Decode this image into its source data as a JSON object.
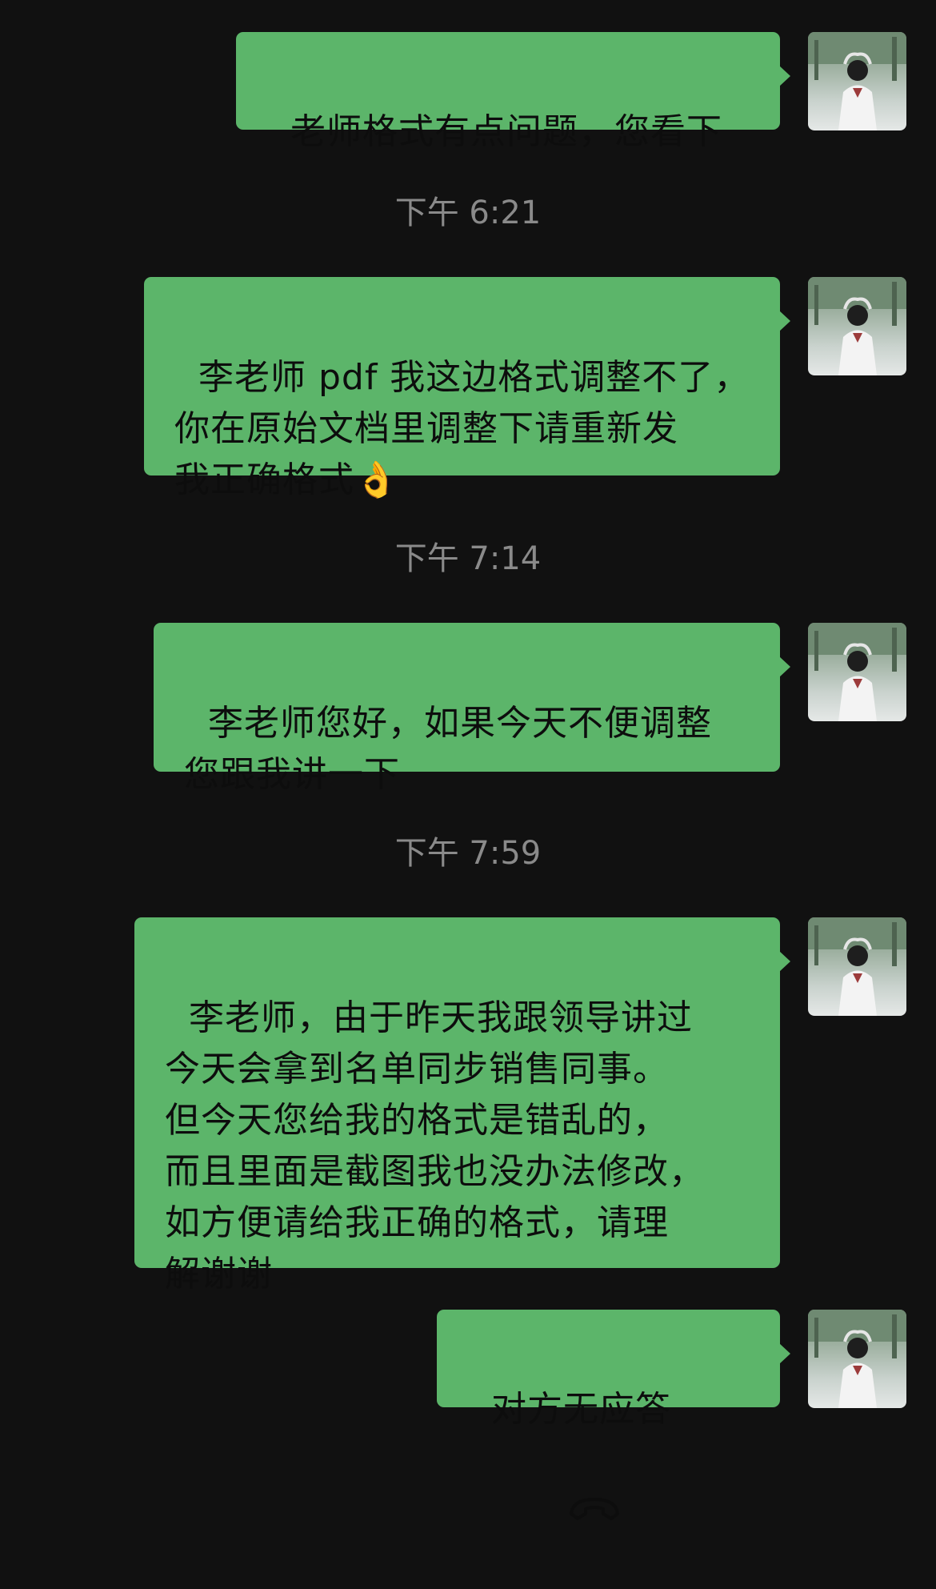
{
  "messages": [
    {
      "text": "老师格式有点问题，您看下"
    },
    {
      "text": "李老师 pdf 我这边格式调整不了，\n你在原始文档里调整下请重新发\n我正确格式👌"
    },
    {
      "text": "李老师您好，如果今天不便调整\n您跟我讲一下"
    },
    {
      "text": "李老师，由于昨天我跟领导讲过\n今天会拿到名单同步销售同事。\n但今天您给我的格式是错乱的，\n而且里面是截图我也没办法修改，\n如方便请给我正确的格式，请理\n解谢谢"
    },
    {
      "text": "对方无应答"
    }
  ],
  "timestamps": [
    "下午 6:21",
    "下午 7:14",
    "下午 7:59"
  ],
  "call_icon": "phone-hangup-icon",
  "colors": {
    "bubble": "#5cb56a",
    "background": "#111111",
    "timestamp": "#8a8a8a"
  }
}
